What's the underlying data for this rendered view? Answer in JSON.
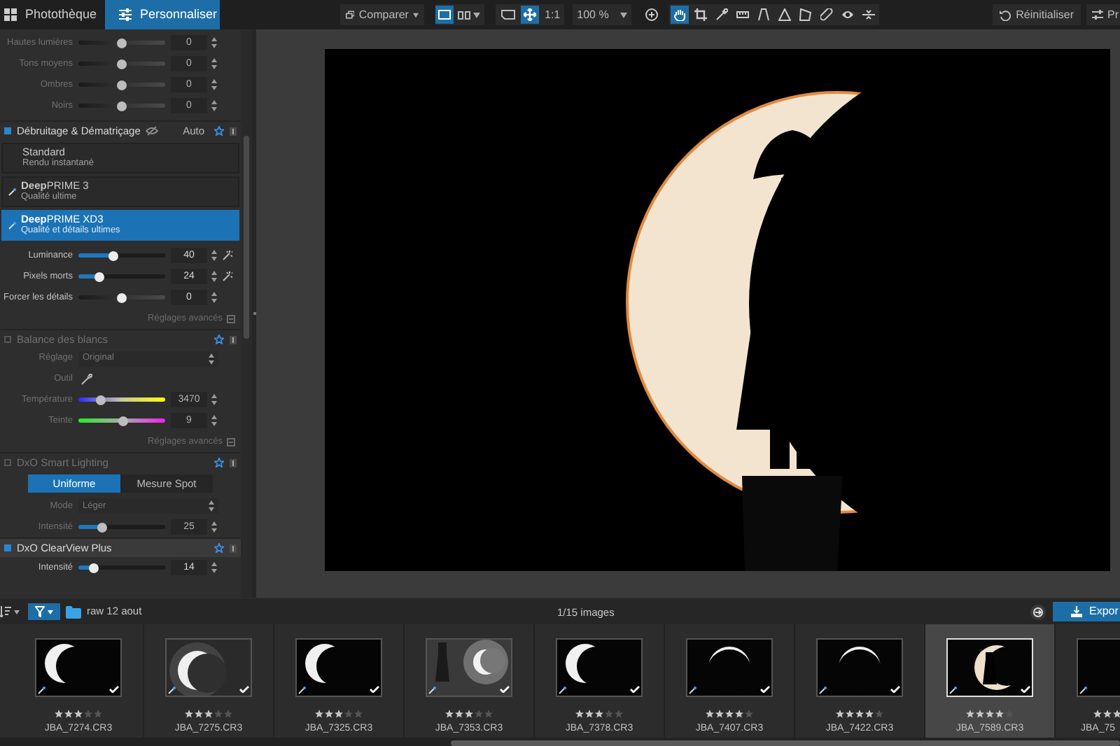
{
  "top_bar": {
    "tabs": [
      {
        "label": "Photothèque",
        "selected": false
      },
      {
        "label": "Personnaliser",
        "selected": true
      }
    ],
    "compare": "Comparer",
    "ratio": "1:1",
    "zoom": "100 %",
    "tools": [
      {
        "kind": "hand",
        "selected": true
      },
      {
        "kind": "crop",
        "selected": false
      },
      {
        "kind": "eyedropper",
        "selected": false
      },
      {
        "kind": "ruler",
        "selected": false
      },
      {
        "kind": "perspective",
        "selected": false
      },
      {
        "kind": "triangle",
        "selected": false
      },
      {
        "kind": "polygon",
        "selected": false
      },
      {
        "kind": "bandage",
        "selected": false
      },
      {
        "kind": "eye",
        "selected": false
      },
      {
        "kind": "split",
        "selected": false
      }
    ],
    "reset": "Réinitialiser",
    "right_button": "Pr"
  },
  "panel": {
    "tone_sliders": [
      {
        "label": "Hautes lumières",
        "value": "0",
        "level": 0.5,
        "kind": "bipolar"
      },
      {
        "label": "Tons moyens",
        "value": "0",
        "level": 0.5,
        "kind": "bipolar"
      },
      {
        "label": "Ombres",
        "value": "0",
        "level": 0.5,
        "kind": "bipolar"
      },
      {
        "label": "Noirs",
        "value": "0",
        "level": 0.5,
        "kind": "bipolar"
      }
    ],
    "denoise": {
      "title": "Débruitage & Dématriçage",
      "enabled": true,
      "badge": "Auto",
      "options": [
        {
          "kind": "standard",
          "title": "Standard",
          "subtitle": "Rendu instantané",
          "selected": false
        },
        {
          "kind": "deepprime",
          "title": "**Deep**PRIME 3",
          "subtitle": "Qualité ultime",
          "selected": false
        },
        {
          "kind": "deepprime",
          "title": "**Deep**PRIME XD3",
          "subtitle": "Qualité et détails ultimes",
          "selected": true
        }
      ],
      "sliders": [
        {
          "label": "Luminance",
          "value": "40",
          "level": 0.4,
          "kind": "fill",
          "wand": true
        },
        {
          "label": "Pixels morts",
          "value": "24",
          "level": 0.24,
          "kind": "fill",
          "wand": true
        },
        {
          "label": "Forcer les détails",
          "value": "0",
          "level": 0.5,
          "kind": "bipolar",
          "wand": false
        }
      ],
      "advanced": "Réglages avancés"
    },
    "white_balance": {
      "title": "Balance des blancs",
      "enabled": false,
      "setting_label": "Réglage",
      "setting_value": "Original",
      "tool_label": "Outil",
      "sliders": [
        {
          "label": "Température",
          "value": "3470",
          "level": 0.25,
          "kind": "temperature"
        },
        {
          "label": "Teinte",
          "value": "9",
          "level": 0.52,
          "kind": "tint"
        }
      ],
      "advanced": "Réglages avancés"
    },
    "smart_lighting": {
      "title": "DxO Smart Lighting",
      "enabled": false,
      "modes": [
        {
          "label": "Uniforme",
          "selected": true
        },
        {
          "label": "Mesure Spot",
          "selected": false
        }
      ],
      "mode_label": "Mode",
      "mode_value": "Léger",
      "sliders": [
        {
          "label": "Intensité",
          "value": "25",
          "level": 0.27,
          "kind": "fill"
        }
      ]
    },
    "clearview": {
      "title": "DxO ClearView Plus",
      "enabled": true,
      "sliders": [
        {
          "label": "Intensité",
          "value": "14",
          "level": 0.17,
          "kind": "fill"
        }
      ]
    }
  },
  "filmstrip": {
    "folder": "raw 12 aout",
    "count": "1/15 images",
    "export": "Expor",
    "items": [
      {
        "name": "JBA_7274.CR3",
        "stars": 3,
        "kind": "crescent",
        "checked": true,
        "selected": false
      },
      {
        "name": "JBA_7275.CR3",
        "stars": 3,
        "kind": "glow",
        "checked": true,
        "selected": false
      },
      {
        "name": "JBA_7325.CR3",
        "stars": 3,
        "kind": "crescent",
        "checked": true,
        "selected": false
      },
      {
        "name": "JBA_7353.CR3",
        "stars": 3,
        "kind": "figure-glow",
        "checked": true,
        "selected": false
      },
      {
        "name": "JBA_7378.CR3",
        "stars": 3,
        "kind": "crescent",
        "checked": true,
        "selected": false
      },
      {
        "name": "JBA_7407.CR3",
        "stars": 4,
        "kind": "arc",
        "checked": true,
        "selected": false
      },
      {
        "name": "JBA_7422.CR3",
        "stars": 4,
        "kind": "arc",
        "checked": true,
        "selected": false
      },
      {
        "name": "JBA_7589.CR3",
        "stars": 4,
        "kind": "figure-moon",
        "checked": true,
        "selected": true
      },
      {
        "name": "JBA_75",
        "stars": 3,
        "kind": "dark",
        "checked": false,
        "selected": false
      }
    ]
  }
}
